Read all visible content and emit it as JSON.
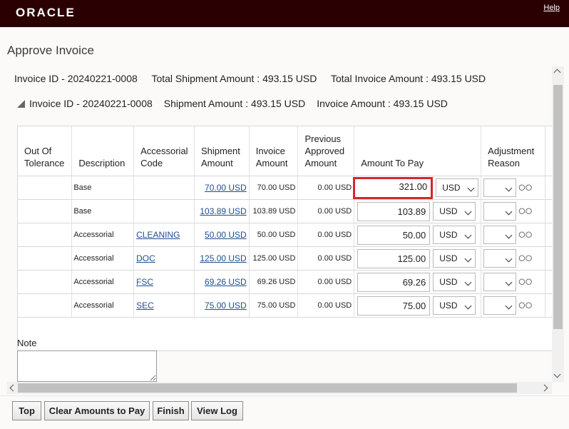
{
  "header": {
    "logo": "ORACLE",
    "help": "Help"
  },
  "page": {
    "title": "Approve Invoice",
    "summary": {
      "invoice_id": "Invoice ID - 20240221-0008",
      "total_shipment": "Total Shipment Amount : 493.15 USD",
      "total_invoice": "Total Invoice Amount : 493.15 USD"
    },
    "sub_summary": {
      "invoice_id": "Invoice ID - 20240221-0008",
      "shipment_amount": "Shipment Amount : 493.15 USD",
      "invoice_amount": "Invoice Amount : 493.15 USD"
    }
  },
  "table": {
    "headers": {
      "out_of_tolerance": "Out Of Tolerance",
      "description": "Description",
      "accessorial_code": "Accessorial Code",
      "shipment_amount": "Shipment Amount",
      "invoice_amount": "Invoice Amount",
      "previous_approved": "Previous Approved Amount",
      "amount_to_pay": "Amount To Pay",
      "adjustment_reason": "Adjustment Reason"
    },
    "rows": [
      {
        "out": "",
        "description": "Base",
        "code": "",
        "shipment": "70.00 USD",
        "invoice": "70.00 USD",
        "previous": "0.00 USD",
        "amount": "321.00",
        "currency": "USD",
        "reason": ""
      },
      {
        "out": "",
        "description": "Base",
        "code": "",
        "shipment": "103.89 USD",
        "invoice": "103.89 USD",
        "previous": "0.00 USD",
        "amount": "103.89",
        "currency": "USD",
        "reason": ""
      },
      {
        "out": "",
        "description": "Accessorial",
        "code": "CLEANING",
        "shipment": "50.00 USD",
        "invoice": "50.00 USD",
        "previous": "0.00 USD",
        "amount": "50.00",
        "currency": "USD",
        "reason": ""
      },
      {
        "out": "",
        "description": "Accessorial",
        "code": "DOC",
        "shipment": "125.00 USD",
        "invoice": "125.00 USD",
        "previous": "0.00 USD",
        "amount": "125.00",
        "currency": "USD",
        "reason": ""
      },
      {
        "out": "",
        "description": "Accessorial",
        "code": "FSC",
        "shipment": "69.26 USD",
        "invoice": "69.26 USD",
        "previous": "0.00 USD",
        "amount": "69.26",
        "currency": "USD",
        "reason": ""
      },
      {
        "out": "",
        "description": "Accessorial",
        "code": "SEC",
        "shipment": "75.00 USD",
        "invoice": "75.00 USD",
        "previous": "0.00 USD",
        "amount": "75.00",
        "currency": "USD",
        "reason": ""
      }
    ]
  },
  "note": {
    "label": "Note",
    "value": ""
  },
  "buttons": {
    "top": "Top",
    "clear": "Clear Amounts to Pay",
    "finish": "Finish",
    "view_log": "View Log"
  },
  "icons": {
    "details": "glasses-icon"
  },
  "colors": {
    "header_bg": "#2b0003",
    "link": "#1f4e8c",
    "focus_border": "#d7262a"
  }
}
